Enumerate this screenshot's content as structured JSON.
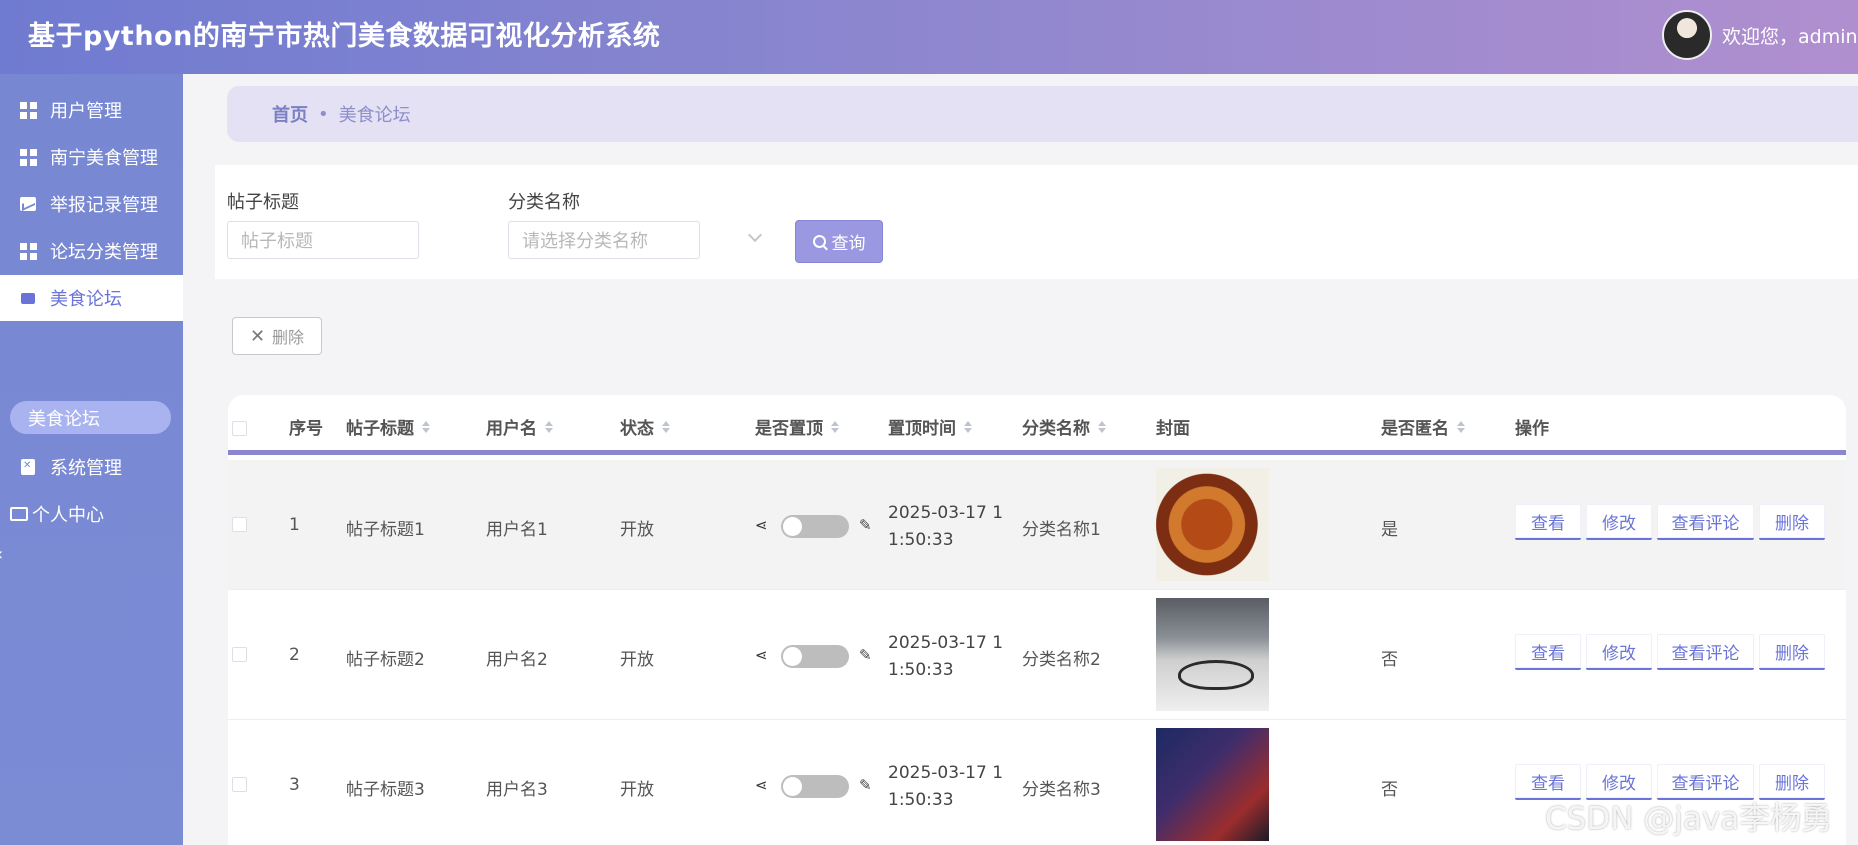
{
  "header": {
    "title": "基于python的南宁市热门美食数据可视化分析系统",
    "welcome": "欢迎您，admin"
  },
  "sidebar": {
    "items": [
      {
        "label": "用户管理",
        "icon": "grid-icon"
      },
      {
        "label": "南宁美食管理",
        "icon": "grid-icon"
      },
      {
        "label": "举报记录管理",
        "icon": "chart-icon"
      },
      {
        "label": "论坛分类管理",
        "icon": "grid-icon"
      },
      {
        "label": "美食论坛",
        "icon": "monitor-icon",
        "active": true
      },
      {
        "label": "系统管理",
        "icon": "clipboard-icon"
      },
      {
        "label": "个人中心",
        "icon": "card-icon"
      }
    ],
    "sub_item": "美食论坛"
  },
  "breadcrumb": {
    "home": "首页",
    "separator": "•",
    "current": "美食论坛"
  },
  "search": {
    "title_label": "帖子标题",
    "title_placeholder": "帖子标题",
    "category_label": "分类名称",
    "category_placeholder": "请选择分类名称",
    "query_button": "查询"
  },
  "toolbar": {
    "delete_button": "删除"
  },
  "table": {
    "columns": [
      "序号",
      "帖子标题",
      "用户名",
      "状态",
      "是否置顶",
      "置顶时间",
      "分类名称",
      "封面",
      "是否匿名",
      "操作"
    ],
    "rows": [
      {
        "index": "1",
        "title": "帖子标题1",
        "username": "用户名1",
        "status": "开放",
        "top_time": "2025-03-17 11:50:33",
        "category": "分类名称1",
        "anonymous": "是",
        "pinned": false
      },
      {
        "index": "2",
        "title": "帖子标题2",
        "username": "用户名2",
        "status": "开放",
        "top_time": "2025-03-17 11:50:33",
        "category": "分类名称2",
        "anonymous": "否",
        "pinned": false
      },
      {
        "index": "3",
        "title": "帖子标题3",
        "username": "用户名3",
        "status": "开放",
        "top_time": "2025-03-17 11:50:33",
        "category": "分类名称3",
        "anonymous": "否",
        "pinned": false
      }
    ],
    "actions": [
      "查看",
      "修改",
      "查看评论",
      "删除"
    ]
  },
  "watermark": "CSDN @java李杨勇",
  "colors": {
    "accent": "#6a74d8",
    "sidebar": "#7787d2",
    "query_button": "#9b98e2"
  }
}
